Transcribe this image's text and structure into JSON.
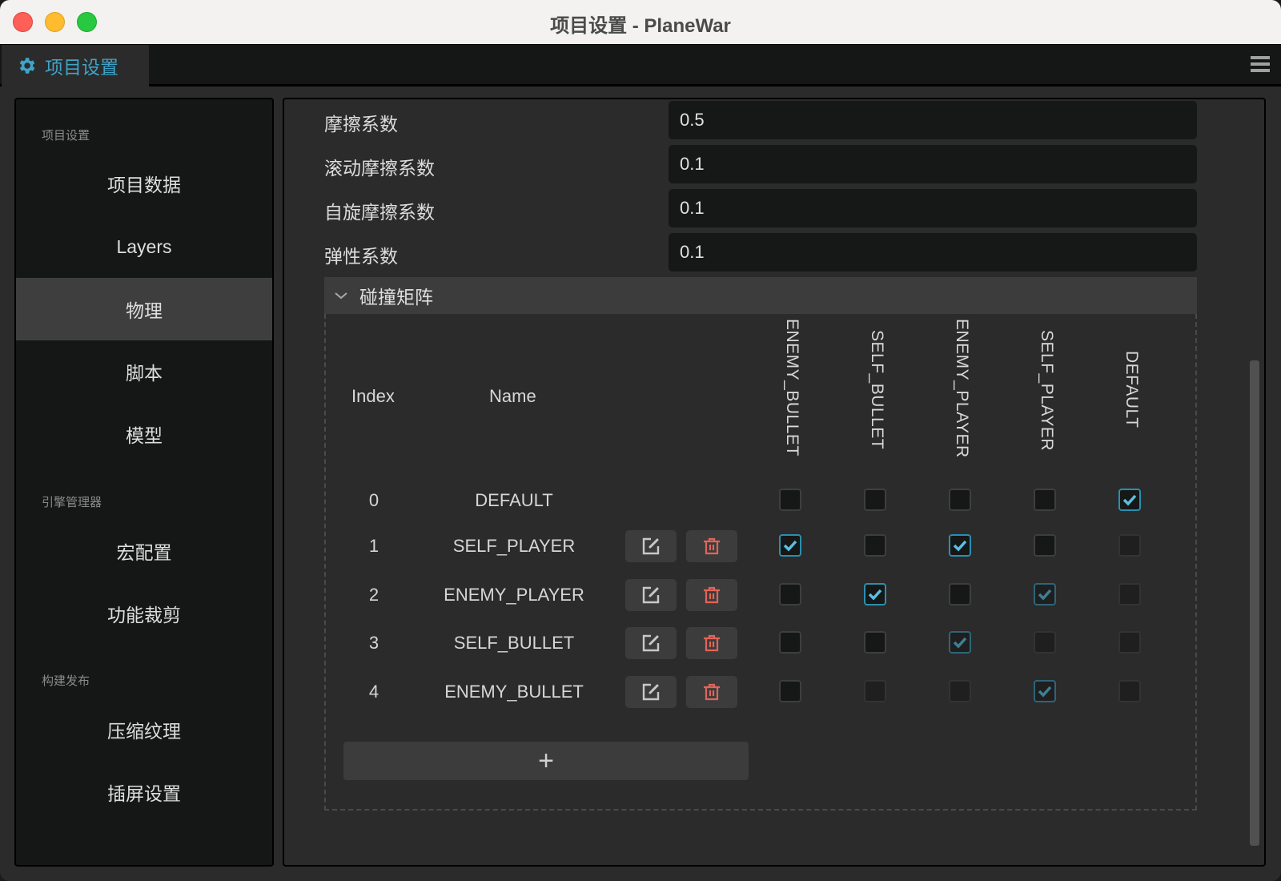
{
  "window": {
    "title": "项目设置 - PlaneWar"
  },
  "tab": {
    "label": "项目设置",
    "icon": "gear-icon"
  },
  "sidebar": {
    "sections": [
      {
        "label": "项目设置",
        "items": [
          "项目数据",
          "Layers",
          "物理",
          "脚本",
          "模型"
        ]
      },
      {
        "label": "引擎管理器",
        "items": [
          "宏配置",
          "功能裁剪"
        ]
      },
      {
        "label": "构建发布",
        "items": [
          "压缩纹理",
          "插屏设置"
        ]
      }
    ],
    "active": "物理"
  },
  "properties": [
    {
      "label": "摩擦系数",
      "value": "0.5"
    },
    {
      "label": "滚动摩擦系数",
      "value": "0.1"
    },
    {
      "label": "自旋摩擦系数",
      "value": "0.1"
    },
    {
      "label": "弹性系数",
      "value": "0.1"
    }
  ],
  "collision_matrix": {
    "title": "碰撞矩阵",
    "expanded": true,
    "headers": {
      "index": "Index",
      "name": "Name"
    },
    "columns": [
      "ENEMY_BULLET",
      "SELF_BULLET",
      "ENEMY_PLAYER",
      "SELF_PLAYER",
      "DEFAULT"
    ],
    "rows": [
      {
        "index": "0",
        "name": "DEFAULT",
        "editable": false,
        "checked": [
          false,
          false,
          false,
          false,
          true
        ],
        "enabled": [
          true,
          true,
          true,
          true,
          true
        ]
      },
      {
        "index": "1",
        "name": "SELF_PLAYER",
        "editable": true,
        "checked": [
          true,
          false,
          true,
          false,
          false
        ],
        "enabled": [
          true,
          true,
          true,
          true,
          false
        ]
      },
      {
        "index": "2",
        "name": "ENEMY_PLAYER",
        "editable": true,
        "checked": [
          false,
          true,
          false,
          true,
          false
        ],
        "enabled": [
          true,
          true,
          true,
          false,
          false
        ]
      },
      {
        "index": "3",
        "name": "SELF_BULLET",
        "editable": true,
        "checked": [
          false,
          false,
          true,
          false,
          false
        ],
        "enabled": [
          true,
          true,
          false,
          false,
          false
        ]
      },
      {
        "index": "4",
        "name": "ENEMY_BULLET",
        "editable": true,
        "checked": [
          false,
          false,
          false,
          true,
          false
        ],
        "enabled": [
          true,
          false,
          false,
          false,
          false
        ]
      }
    ],
    "add_label": "+"
  },
  "colors": {
    "accent": "#3fa4c9",
    "check": "#5bbfe0",
    "delete": "#e2645a"
  }
}
